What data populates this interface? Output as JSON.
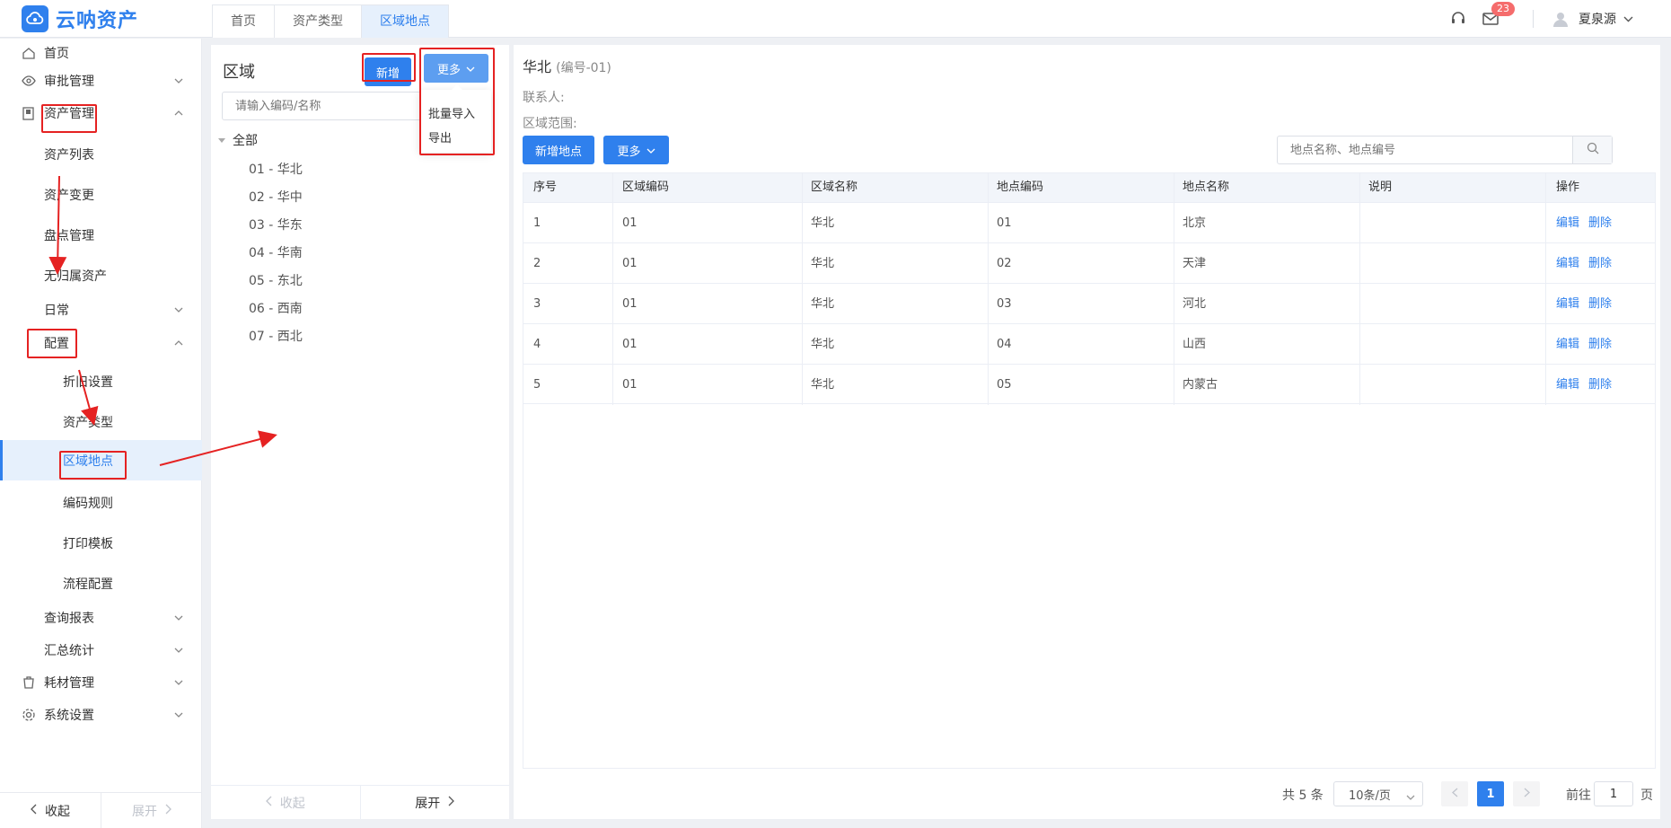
{
  "app": {
    "logo_text": "云呐资产"
  },
  "tabs": [
    {
      "label": "首页"
    },
    {
      "label": "资产类型"
    },
    {
      "label": "区域地点"
    }
  ],
  "header": {
    "mail_count": "23",
    "user_name": "夏泉源"
  },
  "sidebar": {
    "items": [
      {
        "label": "首页",
        "icon": "home-icon"
      },
      {
        "label": "审批管理",
        "icon": "eye-icon"
      },
      {
        "label": "资产管理",
        "icon": "asset-icon"
      },
      {
        "label": "资产列表"
      },
      {
        "label": "资产变更"
      },
      {
        "label": "盘点管理"
      },
      {
        "label": "无归属资产"
      },
      {
        "label": "日常"
      },
      {
        "label": "配置"
      },
      {
        "label": "折旧设置"
      },
      {
        "label": "资产类型"
      },
      {
        "label": "区域地点"
      },
      {
        "label": "编码规则"
      },
      {
        "label": "打印模板"
      },
      {
        "label": "流程配置"
      },
      {
        "label": "查询报表"
      },
      {
        "label": "汇总统计"
      },
      {
        "label": "耗材管理",
        "icon": "consumable-icon"
      },
      {
        "label": "系统设置",
        "icon": "gear-icon"
      }
    ],
    "collapse_label": "收起",
    "expand_label": "展开"
  },
  "region": {
    "title": "区域",
    "add_label": "新增",
    "more_label": "更多",
    "search_placeholder": "请输入编码/名称",
    "tree_root": "全部",
    "nodes": [
      "01 - 华北",
      "02 - 华中",
      "03 - 华东",
      "04 - 华南",
      "05 - 东北",
      "06 - 西南",
      "07 - 西北"
    ],
    "dropdown": [
      "批量导入",
      "导出"
    ],
    "footer_collapse": "收起",
    "footer_expand": "展开"
  },
  "detail": {
    "title": "华北",
    "code": "(编号-01)",
    "contact_label": "联系人:",
    "range_label": "区域范围:",
    "add_location_label": "新增地点",
    "more_label": "更多",
    "search_placeholder": "地点名称、地点编号"
  },
  "table": {
    "columns": [
      "序号",
      "区域编码",
      "区域名称",
      "地点编码",
      "地点名称",
      "说明",
      "操作"
    ],
    "rows": [
      [
        "1",
        "01",
        "华北",
        "01",
        "北京",
        ""
      ],
      [
        "2",
        "01",
        "华北",
        "02",
        "天津",
        ""
      ],
      [
        "3",
        "01",
        "华北",
        "03",
        "河北",
        ""
      ],
      [
        "4",
        "01",
        "华北",
        "04",
        "山西",
        ""
      ],
      [
        "5",
        "01",
        "华北",
        "05",
        "内蒙古",
        ""
      ]
    ],
    "edit_label": "编辑",
    "delete_label": "删除"
  },
  "pagination": {
    "total": "共 5 条",
    "page_size": "10条/页",
    "current_page": "1",
    "goto_label": "前往",
    "goto_value": "1",
    "unit": "页"
  },
  "colors": {
    "accent": "#2f80ed",
    "annotation": "#e52222"
  }
}
